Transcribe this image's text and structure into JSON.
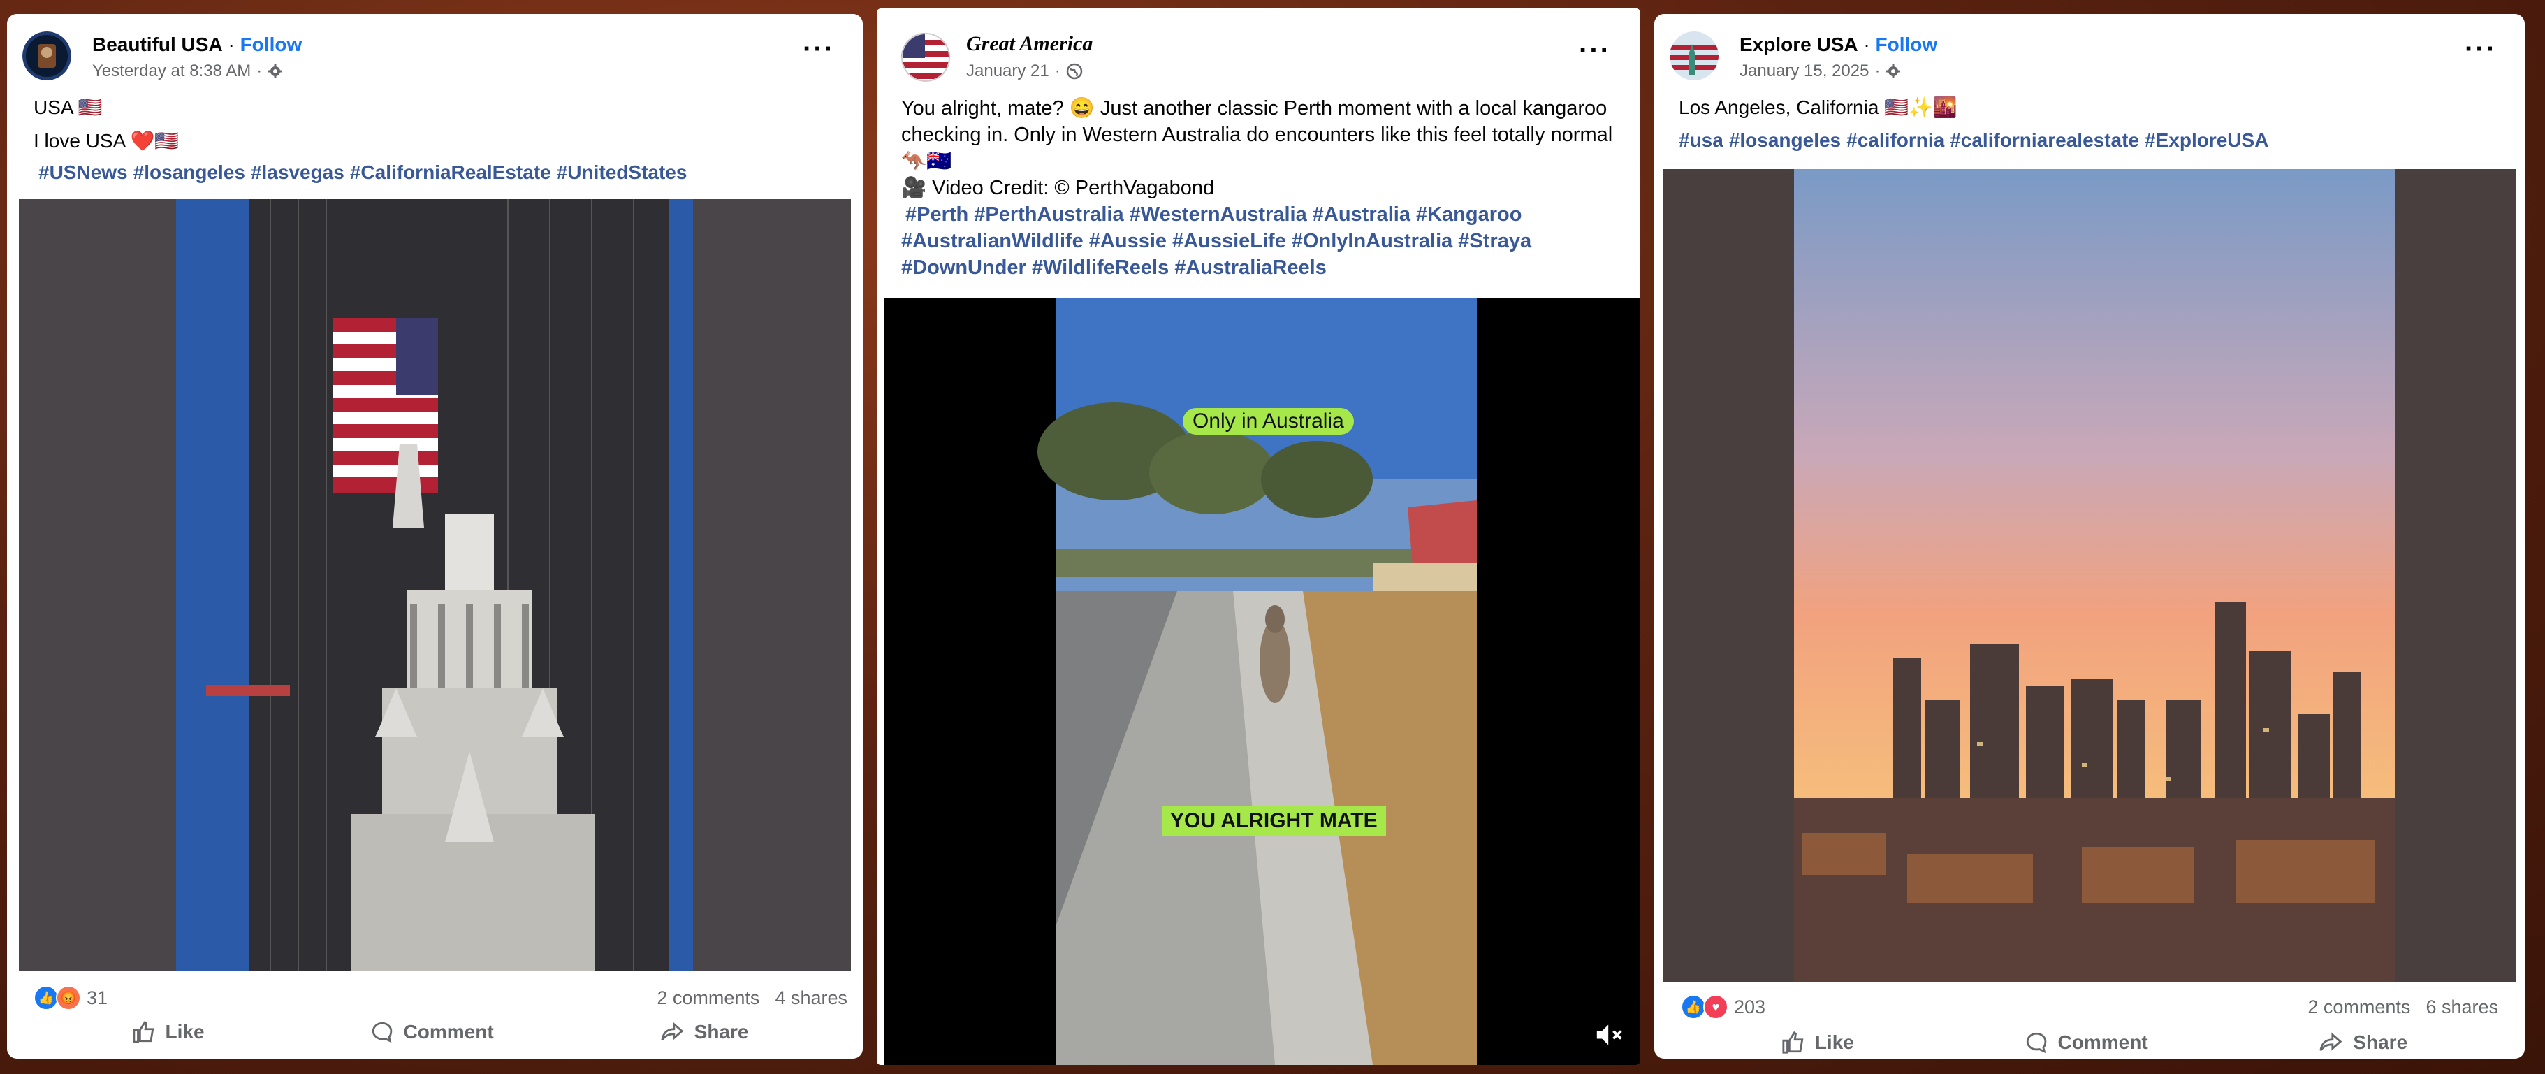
{
  "posts": [
    {
      "author": "Beautiful USA",
      "follow": "Follow",
      "date": "Yesterday at 8:38 AM",
      "line1": "USA 🇺🇸",
      "line2": "I love USA ❤️🇺🇸",
      "hashtags": [
        "#USNews",
        "#losangeles",
        "#lasvegas",
        "#CaliforniaRealEstate",
        "#UnitedStates"
      ],
      "reaction_count": "31",
      "comments": "2 comments",
      "shares": "4 shares",
      "actions": {
        "like": "Like",
        "comment": "Comment",
        "share": "Share"
      }
    },
    {
      "author": "Great America",
      "date": "January 21",
      "text_line1": "You alright, mate? 😄 Just another classic Perth moment with a local kangaroo",
      "text_line2": "checking in. Only in Western Australia do encounters like this feel totally normal",
      "text_line3": "🦘🇦🇺",
      "credit": "🎥 Video Credit: © PerthVagabond",
      "hashtags_line1": [
        "#Perth",
        "#PerthAustralia",
        "#WesternAustralia",
        "#Australia",
        "#Kangaroo"
      ],
      "hashtags_line2": [
        "#AustralianWildlife",
        "#Aussie",
        "#AussieLife",
        "#OnlyInAustralia",
        "#Straya"
      ],
      "hashtags_line3": [
        "#DownUnder",
        "#WildlifeReels",
        "#AustraliaReels"
      ],
      "video_caption_top": "Only in Australia",
      "video_caption_bottom": "YOU ALRIGHT MATE"
    },
    {
      "author": "Explore USA",
      "follow": "Follow",
      "date": "January 15, 2025",
      "line1": "Los Angeles, California 🇺🇸✨🌇",
      "hashtags": [
        "#usa",
        "#losangeles",
        "#california",
        "#californiarealestate",
        "#ExploreUSA"
      ],
      "reaction_count": "203",
      "comments": "2 comments",
      "shares": "6 shares",
      "actions": {
        "like": "Like",
        "comment": "Comment",
        "share": "Share"
      }
    }
  ],
  "separator": "·",
  "colors": {
    "link": "#385898",
    "follow": "#1877f2",
    "meta": "#65676b",
    "caption_bg": "#a6e84a"
  }
}
